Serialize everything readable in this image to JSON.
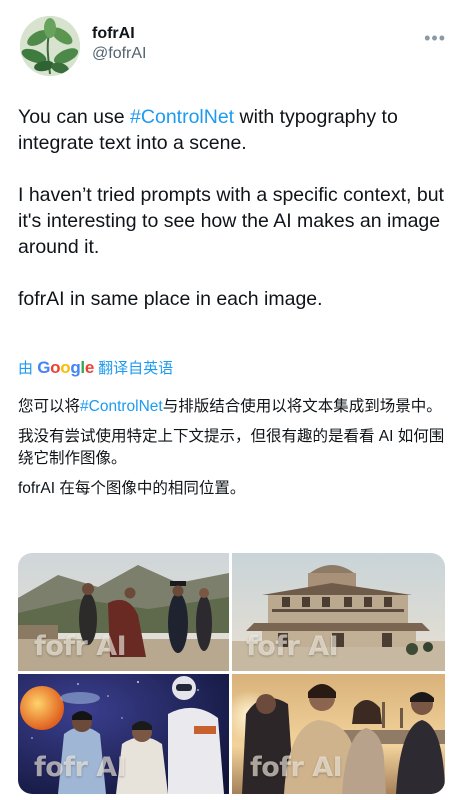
{
  "user": {
    "display_name": "fofrAI",
    "handle": "@fofrAI",
    "more_icon": "more-dots-icon"
  },
  "tweet": {
    "line1_pre": "You can use ",
    "hashtag": "#ControlNet",
    "line1_post": " with typography to integrate text into a scene.",
    "para2": "I haven’t tried prompts with a specific context, but it's interesting to see how the AI makes an image around it.",
    "para3": "fofrAI in same place in each image."
  },
  "translation": {
    "by": "由",
    "logo": [
      "G",
      "o",
      "o",
      "g",
      "l",
      "e"
    ],
    "action": "翻译自英语"
  },
  "translated": {
    "p1_pre": "您可以将",
    "p1_hashtag": "#ControlNet",
    "p1_post": "与排版结合使用以将文本集成到场景中。",
    "p2": "我没有尝试使用特定上下文提示，但很有趣的是看看 AI 如何围绕它制作图像。",
    "p3": "fofrAI 在每个图像中的相同位置。"
  },
  "images": [
    {
      "watermark": "fofr AI"
    },
    {
      "watermark": "fofr AI"
    },
    {
      "watermark": "fofr AI"
    },
    {
      "watermark": "fofr AI"
    }
  ]
}
